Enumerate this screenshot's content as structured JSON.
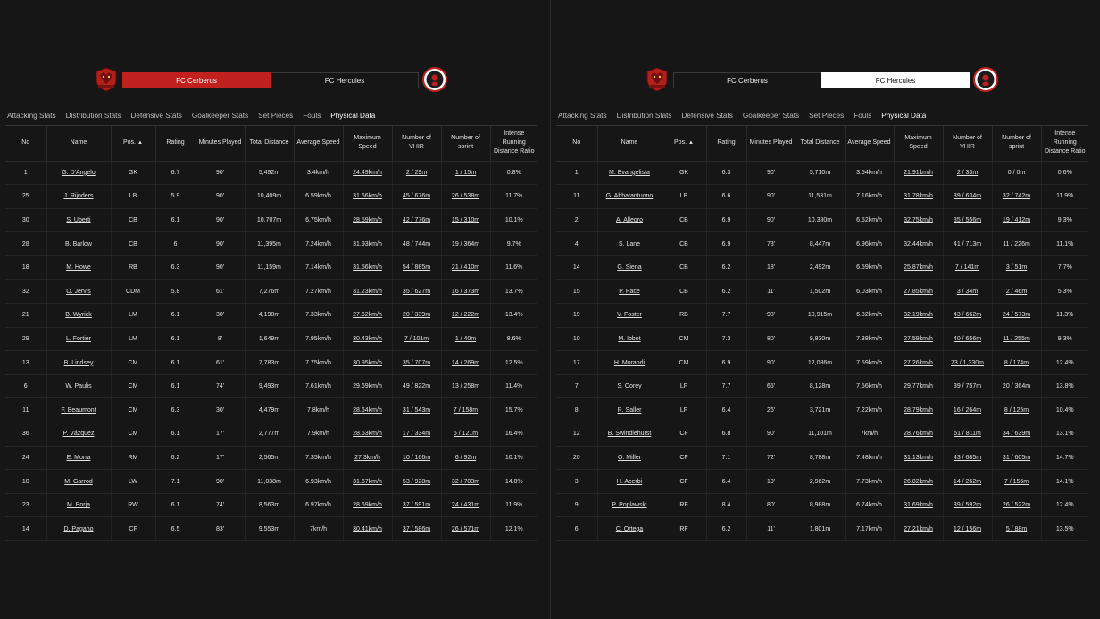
{
  "tabs": [
    "Attacking Stats",
    "Distribution Stats",
    "Defensive Stats",
    "Goalkeeper Stats",
    "Set Pieces",
    "Fouls",
    "Physical Data"
  ],
  "active_tab": "Physical Data",
  "columns": [
    "No",
    "Name",
    "Pos.",
    "Rating",
    "Minutes Played",
    "Total Distance",
    "Average Speed",
    "Maximum Speed",
    "Number of VHIR",
    "Number of sprint",
    "Intense Running Distance Ratio"
  ],
  "sort_indicator": "▲",
  "colors": {
    "accent_red": "#c0211e",
    "background": "#161616",
    "text": "#e2e2e2"
  },
  "panels": [
    {
      "team_left": "FC Cerberus",
      "team_right": "FC Hercules",
      "selected": "left",
      "rows": [
        [
          "1",
          "G. D'Angelo",
          "GK",
          "6.7",
          "90'",
          "5,492m",
          "3.4km/h",
          "24.49km/h",
          "2 / 29m",
          "1 / 15m",
          "0.8%"
        ],
        [
          "25",
          "J. Rijnders",
          "LB",
          "5.9",
          "90'",
          "10,409m",
          "6.59km/h",
          "31.66km/h",
          "45 / 676m",
          "26 / 538m",
          "11.7%"
        ],
        [
          "30",
          "S. Uberti",
          "CB",
          "6.1",
          "90'",
          "10,707m",
          "6.75km/h",
          "28.59km/h",
          "42 / 776m",
          "15 / 310m",
          "10.1%"
        ],
        [
          "28",
          "B. Barlow",
          "CB",
          "6",
          "90'",
          "11,395m",
          "7.24km/h",
          "31.93km/h",
          "48 / 744m",
          "19 / 364m",
          "9.7%"
        ],
        [
          "18",
          "M. Howe",
          "RB",
          "6.3",
          "90'",
          "11,159m",
          "7.14km/h",
          "31.56km/h",
          "54 / 885m",
          "21 / 410m",
          "11.6%"
        ],
        [
          "32",
          "O. Jervis",
          "CDM",
          "5.8",
          "61'",
          "7,276m",
          "7.27km/h",
          "31.23km/h",
          "35 / 627m",
          "16 / 373m",
          "13.7%"
        ],
        [
          "21",
          "B. Wyrick",
          "LM",
          "6.1",
          "30'",
          "4,198m",
          "7.33km/h",
          "27.62km/h",
          "20 / 339m",
          "12 / 222m",
          "13.4%"
        ],
        [
          "29",
          "L. Fortier",
          "LM",
          "6.1",
          "8'",
          "1,649m",
          "7.95km/h",
          "30.43km/h",
          "7 / 101m",
          "1 / 40m",
          "8.6%"
        ],
        [
          "13",
          "B. Lindsey",
          "CM",
          "6.1",
          "61'",
          "7,783m",
          "7.75km/h",
          "30.95km/h",
          "35 / 707m",
          "14 / 269m",
          "12.5%"
        ],
        [
          "6",
          "W. Paulis",
          "CM",
          "6.1",
          "74'",
          "9,493m",
          "7.61km/h",
          "29.69km/h",
          "49 / 822m",
          "13 / 258m",
          "11.4%"
        ],
        [
          "11",
          "F. Beaumont",
          "CM",
          "6.3",
          "30'",
          "4,479m",
          "7.8km/h",
          "28.64km/h",
          "31 / 543m",
          "7 / 158m",
          "15.7%"
        ],
        [
          "36",
          "P. Vázquez",
          "CM",
          "6.1",
          "17'",
          "2,777m",
          "7.9km/h",
          "28.63km/h",
          "17 / 334m",
          "6 / 121m",
          "16.4%"
        ],
        [
          "24",
          "E. Morra",
          "RM",
          "6.2",
          "17'",
          "2,565m",
          "7.35km/h",
          "27.3km/h",
          "10 / 166m",
          "6 / 92m",
          "10.1%"
        ],
        [
          "10",
          "M. Garrod",
          "LW",
          "7.1",
          "90'",
          "11,038m",
          "6.93km/h",
          "31.67km/h",
          "53 / 928m",
          "32 / 703m",
          "14.8%"
        ],
        [
          "23",
          "M. Borja",
          "RW",
          "6.1",
          "74'",
          "8,563m",
          "6.97km/h",
          "28.69km/h",
          "37 / 591m",
          "24 / 431m",
          "11.9%"
        ],
        [
          "14",
          "D. Pagano",
          "CF",
          "6.5",
          "83'",
          "9,553m",
          "7km/h",
          "30.41km/h",
          "37 / 586m",
          "26 / 571m",
          "12.1%"
        ]
      ]
    },
    {
      "team_left": "FC Cerberus",
      "team_right": "FC Hercules",
      "selected": "right",
      "rows": [
        [
          "1",
          "M. Evangelista",
          "GK",
          "6.3",
          "90'",
          "5,710m",
          "3.54km/h",
          "21.91km/h",
          "2 / 33m",
          "0 / 0m",
          "0.6%"
        ],
        [
          "11",
          "G. Abbatantuono",
          "LB",
          "6.6",
          "90'",
          "11,531m",
          "7.16km/h",
          "31.78km/h",
          "39 / 634m",
          "32 / 742m",
          "11.9%"
        ],
        [
          "2",
          "A. Allegro",
          "CB",
          "6.9",
          "90'",
          "10,380m",
          "6.52km/h",
          "32.75km/h",
          "35 / 556m",
          "19 / 412m",
          "9.3%"
        ],
        [
          "4",
          "S. Lane",
          "CB",
          "6.9",
          "73'",
          "8,447m",
          "6.96km/h",
          "32.44km/h",
          "41 / 713m",
          "11 / 226m",
          "11.1%"
        ],
        [
          "14",
          "G. Siena",
          "CB",
          "6.2",
          "18'",
          "2,492m",
          "6.59km/h",
          "25.87km/h",
          "7 / 141m",
          "3 / 51m",
          "7.7%"
        ],
        [
          "15",
          "P. Pace",
          "CB",
          "6.2",
          "11'",
          "1,502m",
          "6.03km/h",
          "27.85km/h",
          "3 / 34m",
          "2 / 46m",
          "5.3%"
        ],
        [
          "19",
          "V. Foster",
          "RB",
          "7.7",
          "90'",
          "10,915m",
          "6.82km/h",
          "32.19km/h",
          "43 / 662m",
          "24 / 573m",
          "11.3%"
        ],
        [
          "10",
          "M. Ibbot",
          "CM",
          "7.3",
          "80'",
          "9,830m",
          "7.38km/h",
          "27.59km/h",
          "40 / 656m",
          "11 / 255m",
          "9.3%"
        ],
        [
          "17",
          "H. Morandi",
          "CM",
          "6.9",
          "90'",
          "12,086m",
          "7.59km/h",
          "27.26km/h",
          "73 / 1,330m",
          "8 / 174m",
          "12.4%"
        ],
        [
          "7",
          "S. Corey",
          "LF",
          "7.7",
          "65'",
          "8,128m",
          "7.56km/h",
          "29.77km/h",
          "39 / 757m",
          "20 / 364m",
          "13.8%"
        ],
        [
          "8",
          "R. Saller",
          "LF",
          "6.4",
          "26'",
          "3,721m",
          "7.22km/h",
          "28.79km/h",
          "16 / 264m",
          "8 / 125m",
          "10.4%"
        ],
        [
          "12",
          "B. Swindlehurst",
          "CF",
          "6.8",
          "90'",
          "11,101m",
          "7km/h",
          "28.76km/h",
          "51 / 811m",
          "34 / 639m",
          "13.1%"
        ],
        [
          "20",
          "O. Miller",
          "CF",
          "7.1",
          "72'",
          "8,788m",
          "7.48km/h",
          "31.13km/h",
          "43 / 685m",
          "31 / 605m",
          "14.7%"
        ],
        [
          "3",
          "H. Acerbi",
          "CF",
          "6.4",
          "19'",
          "2,962m",
          "7.73km/h",
          "26.82km/h",
          "14 / 262m",
          "7 / 156m",
          "14.1%"
        ],
        [
          "9",
          "P. Poplawski",
          "RF",
          "8.4",
          "80'",
          "8,988m",
          "6.74km/h",
          "31.69km/h",
          "39 / 592m",
          "26 / 522m",
          "12.4%"
        ],
        [
          "6",
          "C. Ortega",
          "RF",
          "6.2",
          "11'",
          "1,801m",
          "7.17km/h",
          "27.21km/h",
          "12 / 156m",
          "5 / 88m",
          "13.5%"
        ]
      ]
    }
  ]
}
